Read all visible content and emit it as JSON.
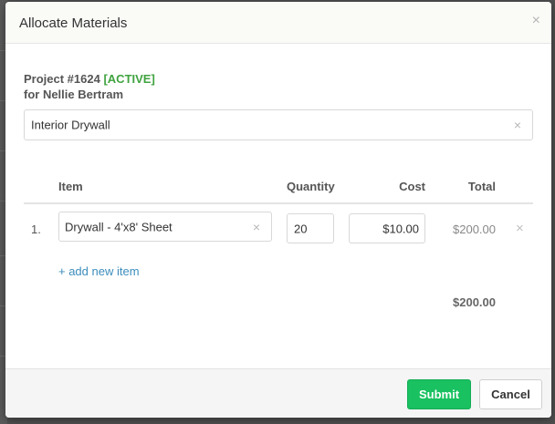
{
  "modal": {
    "title": "Allocate Materials",
    "close_glyph": "×"
  },
  "project": {
    "label": "Project #1624",
    "status": "[ACTIVE]",
    "status_color": "#3fa33f",
    "client_line": "for Nellie Bertram"
  },
  "task_field": {
    "value": "Interior Drywall",
    "clear_glyph": "×"
  },
  "table": {
    "headers": {
      "item": "Item",
      "quantity": "Quantity",
      "cost": "Cost",
      "total": "Total"
    },
    "rows": [
      {
        "index": "1.",
        "item": "Drywall - 4'x8' Sheet",
        "quantity": "20",
        "cost": "$10.00",
        "total": "$200.00",
        "remove_glyph": "×",
        "clear_glyph": "×"
      }
    ],
    "add_item_label": "+ add new item",
    "grand_total": "$200.00"
  },
  "footer": {
    "submit_label": "Submit",
    "cancel_label": "Cancel",
    "submit_color": "#19c160"
  }
}
